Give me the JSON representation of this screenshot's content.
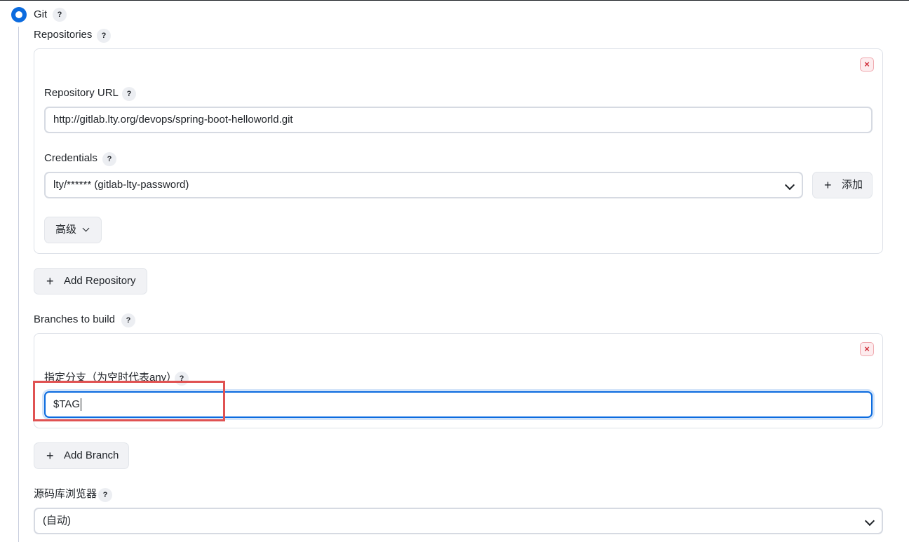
{
  "scm": {
    "label": "Git",
    "help": "?"
  },
  "repositories": {
    "label": "Repositories",
    "help": "?",
    "close_label": "×",
    "url_label": "Repository URL",
    "url_value": "http://gitlab.lty.org/devops/spring-boot-helloworld.git",
    "credentials_label": "Credentials",
    "credentials_value": "lty/****** (gitlab-lty-password)",
    "add_credentials_label": "添加",
    "advanced_label": "高级",
    "add_repository_label": "Add Repository"
  },
  "branches": {
    "label": "Branches to build",
    "help": "?",
    "close_label": "×",
    "specifier_label": "指定分支（为空时代表any）",
    "specifier_value": "$TAG",
    "add_branch_label": "Add Branch"
  },
  "browser": {
    "label": "源码库浏览器",
    "help": "?",
    "value": "(自动)"
  },
  "colors": {
    "accent": "#0b6bdf",
    "highlight": "#e05252",
    "danger": "#d0313d"
  },
  "icons": {
    "plus": "+"
  }
}
